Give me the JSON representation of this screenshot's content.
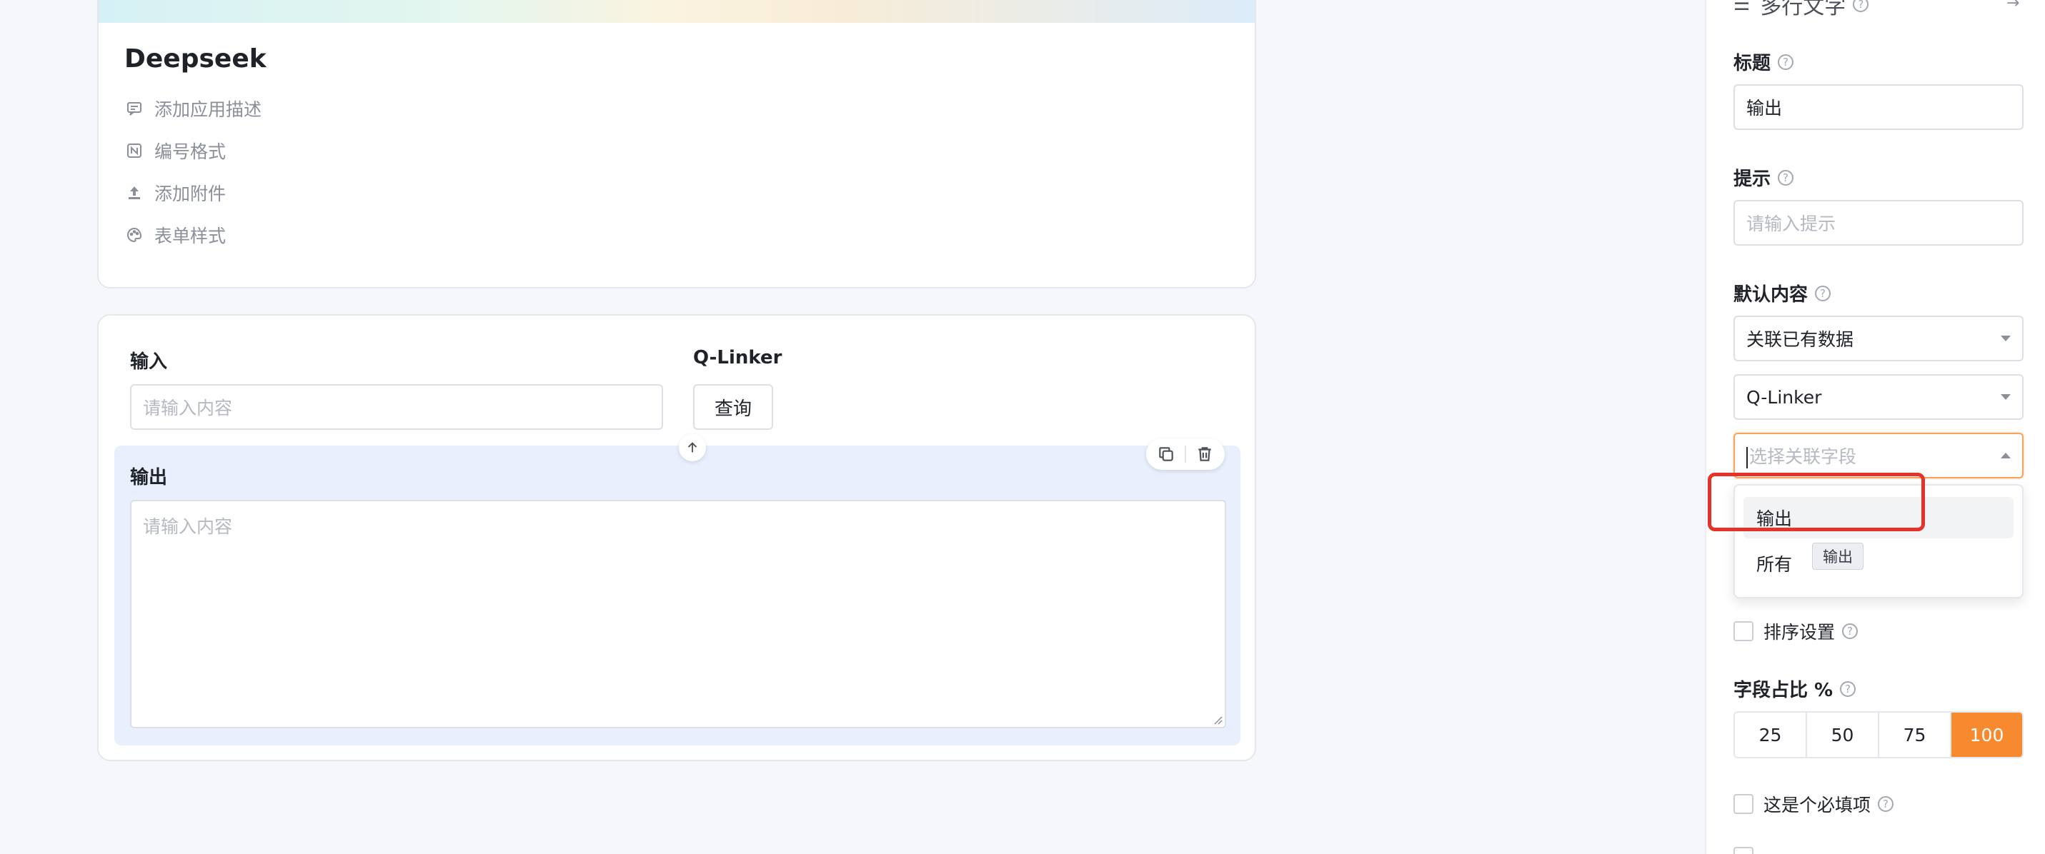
{
  "app": {
    "title": "Deepseek",
    "meta": [
      {
        "label": "添加应用描述",
        "icon": "comment-icon"
      },
      {
        "label": "编号格式",
        "icon": "number-format-icon"
      },
      {
        "label": "添加附件",
        "icon": "upload-icon"
      },
      {
        "label": "表单样式",
        "icon": "palette-icon"
      }
    ]
  },
  "form": {
    "input_field": {
      "label": "输入",
      "placeholder": "请输入内容"
    },
    "linker_field": {
      "label": "Q-Linker",
      "button": "查询"
    },
    "output_field": {
      "label": "输出",
      "placeholder": "请输入内容"
    }
  },
  "panel": {
    "top_title": "多行文字",
    "title_field": {
      "label": "标题",
      "value": "输出"
    },
    "hint_field": {
      "label": "提示",
      "placeholder": "请输入提示"
    },
    "default_content": {
      "label": "默认内容",
      "source": "关联已有数据",
      "linker": "Q-Linker",
      "field_placeholder": "选择关联字段",
      "options": [
        "输出",
        "所有"
      ],
      "tooltip": "输出"
    },
    "sort_setting": "排序设置",
    "width_ratio": {
      "label": "字段占比 %",
      "options": [
        "25",
        "50",
        "75",
        "100"
      ],
      "selected": "100"
    },
    "required": "这是个必填项"
  },
  "colors": {
    "accent": "#f7892e",
    "highlight": "#e5332a",
    "output_bg": "#e9effc"
  }
}
